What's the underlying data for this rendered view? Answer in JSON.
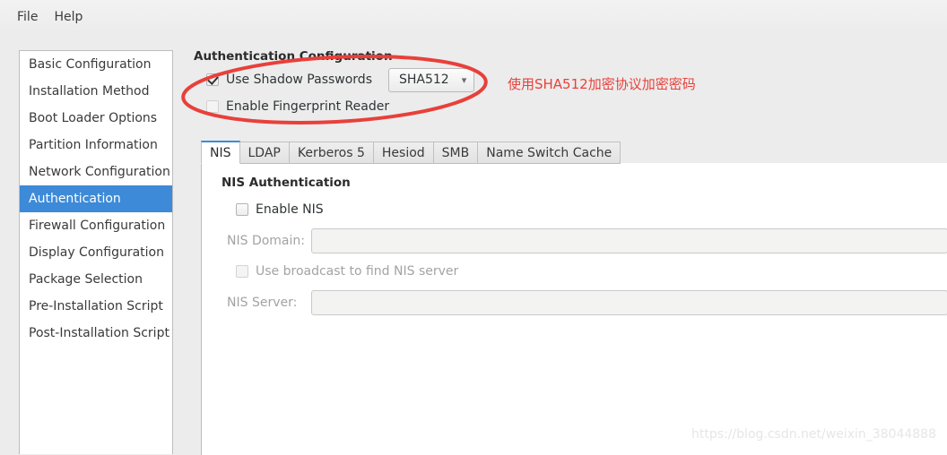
{
  "menubar": {
    "items": [
      {
        "label": "File"
      },
      {
        "label": "Help"
      }
    ]
  },
  "sidebar": {
    "items": [
      {
        "label": "Basic Configuration"
      },
      {
        "label": "Installation Method"
      },
      {
        "label": "Boot Loader Options"
      },
      {
        "label": "Partition Information"
      },
      {
        "label": "Network Configuration"
      },
      {
        "label": "Authentication"
      },
      {
        "label": "Firewall Configuration"
      },
      {
        "label": "Display Configuration"
      },
      {
        "label": "Package Selection"
      },
      {
        "label": "Pre-Installation Script"
      },
      {
        "label": "Post-Installation Script"
      }
    ],
    "selected": "Authentication",
    "selected_color": "#3d8ad8"
  },
  "auth": {
    "title": "Authentication Configuration",
    "shadow_passwords": {
      "label": "Use Shadow Passwords",
      "checked": true
    },
    "algorithm_combo": {
      "value": "SHA512",
      "chevron": "chevron-down-icon"
    },
    "fingerprint": {
      "label": "Enable Fingerprint Reader",
      "checked": false
    }
  },
  "tabs": [
    {
      "label": "NIS",
      "active": true
    },
    {
      "label": "LDAP",
      "active": false
    },
    {
      "label": "Kerberos 5",
      "active": false
    },
    {
      "label": "Hesiod",
      "active": false
    },
    {
      "label": "SMB",
      "active": false
    },
    {
      "label": "Name Switch Cache",
      "active": false
    }
  ],
  "nis_page": {
    "title": "NIS Authentication",
    "enable_nis": {
      "label": "Enable NIS",
      "checked": false
    },
    "domain": {
      "label": "NIS Domain:",
      "value": "",
      "disabled": true
    },
    "broadcast": {
      "label": "Use broadcast to find NIS server",
      "checked": false,
      "disabled": true
    },
    "server": {
      "label": "NIS Server:",
      "value": "",
      "disabled": true
    }
  },
  "annotations": {
    "ellipse_color": "#e8403a",
    "note_text": "使用SHA512加密协议加密密码"
  },
  "watermark": {
    "text": "https://blog.csdn.net/weixin_38044888"
  }
}
